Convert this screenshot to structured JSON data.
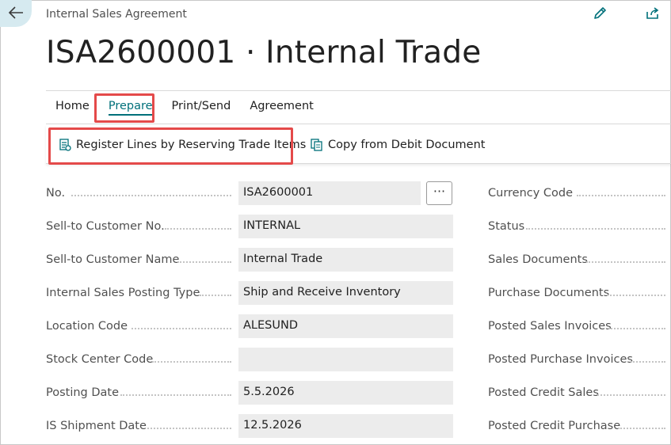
{
  "header": {
    "caption": "Internal Sales Agreement",
    "title": "ISA2600001 · Internal Trade"
  },
  "tabs": [
    {
      "label": "Home"
    },
    {
      "label": "Prepare"
    },
    {
      "label": "Print/Send"
    },
    {
      "label": "Agreement"
    }
  ],
  "actions": {
    "register_lines": "Register Lines by Reserving Trade Items",
    "copy_debit": "Copy from Debit Document"
  },
  "fields": [
    {
      "label": "No.",
      "value": "ISA2600001"
    },
    {
      "label": "Sell-to Customer No.",
      "value": "INTERNAL"
    },
    {
      "label": "Sell-to Customer Name",
      "value": "Internal Trade"
    },
    {
      "label": "Internal Sales Posting Type",
      "value": "Ship and Receive Inventory"
    },
    {
      "label": "Location Code",
      "value": "ALESUND"
    },
    {
      "label": "Stock Center Code",
      "value": ""
    },
    {
      "label": "Posting Date",
      "value": "5.5.2026"
    },
    {
      "label": "IS Shipment Date",
      "value": "12.5.2026"
    }
  ],
  "ellipsis": "···",
  "right_fields": [
    {
      "label": "Currency Code"
    },
    {
      "label": "Status"
    },
    {
      "label": "Sales Documents"
    },
    {
      "label": "Purchase Documents"
    },
    {
      "label": "Posted Sales Invoices"
    },
    {
      "label": "Posted Purchase Invoices"
    },
    {
      "label": "Posted Credit Sales"
    },
    {
      "label": "Posted Credit Purchase"
    }
  ],
  "colors": {
    "accent": "#00707a",
    "highlight": "#e44a4a",
    "back_bg": "#d6eaf0",
    "field_bg": "#ececec"
  },
  "icons": [
    "back-arrow-icon",
    "edit-pencil-icon",
    "share-icon",
    "register-lines-icon",
    "copy-document-icon"
  ]
}
